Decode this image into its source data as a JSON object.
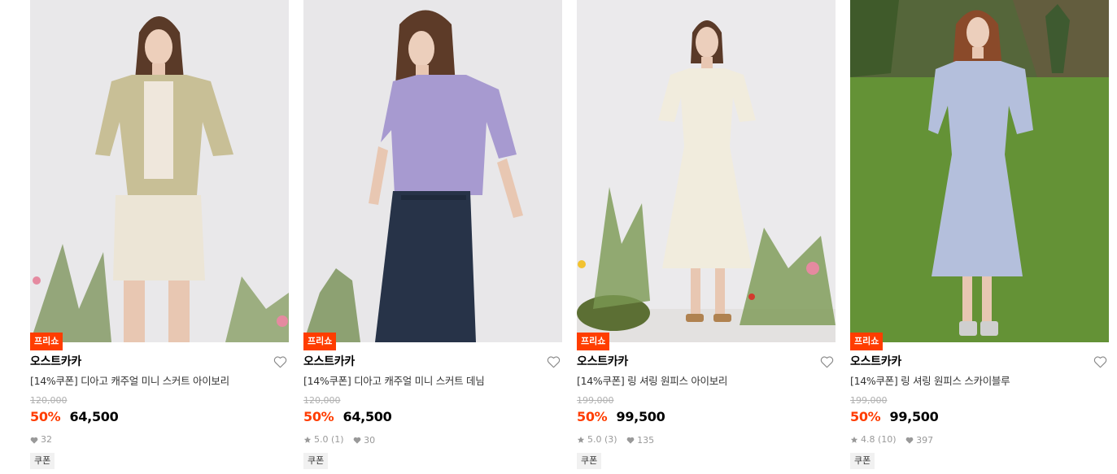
{
  "colors": {
    "accent": "#ff3d00",
    "price": "#000000",
    "muted": "#999999",
    "strike": "#b0b0b0",
    "coupon_bg": "#f1f1f1"
  },
  "products": [
    {
      "badge": "프리쇼",
      "brand": "오스트카카",
      "title": "[14%쿠폰] 디아고 캐주얼 미니 스커트 아이보리",
      "original_price": "120,000",
      "discount": "50%",
      "sale_price": "64,500",
      "rating": "",
      "review_count": "",
      "likes": "32",
      "tag": "쿠폰",
      "image": "product-photo-beige-jacket-ivory-mini-skirt",
      "wishlist_icon": "heart-outline-icon"
    },
    {
      "badge": "프리쇼",
      "brand": "오스트카카",
      "title": "[14%쿠폰] 디아고 캐주얼 미니 스커트 데님",
      "original_price": "120,000",
      "discount": "50%",
      "sale_price": "64,500",
      "rating": "5.0",
      "review_count": "(1)",
      "likes": "30",
      "tag": "쿠폰",
      "image": "product-photo-lavender-top-denim-mini-skirt",
      "wishlist_icon": "heart-outline-icon"
    },
    {
      "badge": "프리쇼",
      "brand": "오스트카카",
      "title": "[14%쿠폰] 링 셔링 원피스 아이보리",
      "original_price": "199,000",
      "discount": "50%",
      "sale_price": "99,500",
      "rating": "5.0",
      "review_count": "(3)",
      "likes": "135",
      "tag": "쿠폰",
      "image": "product-photo-ivory-shirring-dress",
      "wishlist_icon": "heart-outline-icon"
    },
    {
      "badge": "프리쇼",
      "brand": "오스트카카",
      "title": "[14%쿠폰] 링 셔링 원피스 스카이블루",
      "original_price": "199,000",
      "discount": "50%",
      "sale_price": "99,500",
      "rating": "4.8",
      "review_count": "(10)",
      "likes": "397",
      "tag": "쿠폰",
      "image": "product-photo-skyblue-shirring-dress-meadow",
      "wishlist_icon": "heart-outline-icon"
    }
  ]
}
